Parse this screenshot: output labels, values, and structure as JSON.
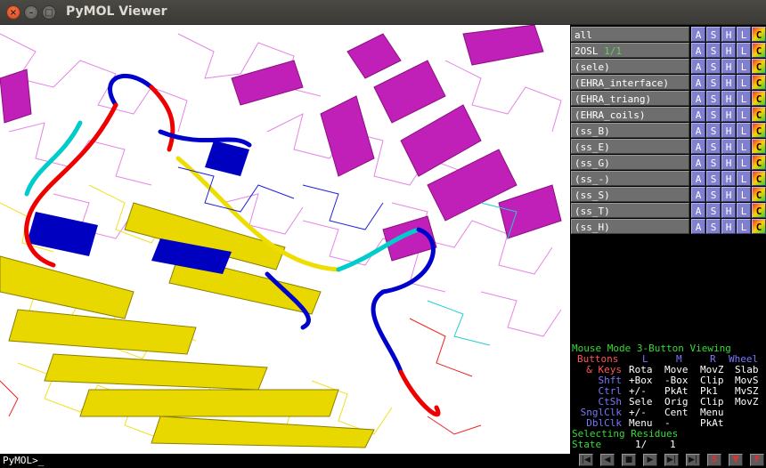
{
  "window": {
    "title": "PyMOL Viewer",
    "close_glyph": "×",
    "min_glyph": "–",
    "max_glyph": "□"
  },
  "viewport": {
    "description_icon": "molecular-viewport",
    "colors": {
      "chain_b": "#dd33cc",
      "chain_a": "#eedd00",
      "loop_blue": "#0000cc",
      "loop_red": "#ee0000",
      "loop_cyan": "#00cccc",
      "background": "#ffffff"
    }
  },
  "command": {
    "prompt": "PyMOL>_"
  },
  "objects": [
    {
      "name": "all",
      "suffix": ""
    },
    {
      "name": "2OSL",
      "suffix": "1/1"
    },
    {
      "name": "(sele)",
      "suffix": ""
    },
    {
      "name": "(EHRA_interface)",
      "suffix": ""
    },
    {
      "name": "(EHRA_triang)",
      "suffix": ""
    },
    {
      "name": "(EHRA_coils)",
      "suffix": ""
    },
    {
      "name": "(ss_B)",
      "suffix": ""
    },
    {
      "name": "(ss_E)",
      "suffix": ""
    },
    {
      "name": "(ss_G)",
      "suffix": ""
    },
    {
      "name": "(ss_-)",
      "suffix": ""
    },
    {
      "name": "(ss_S)",
      "suffix": ""
    },
    {
      "name": "(ss_T)",
      "suffix": ""
    },
    {
      "name": "(ss_H)",
      "suffix": ""
    }
  ],
  "object_buttons": [
    "A",
    "S",
    "H",
    "L",
    "C"
  ],
  "mouse": {
    "mode_label": "Mouse Mode 3-Button Viewing",
    "buttons_row": {
      "label": "Buttons",
      "L": "L",
      "M": "M",
      "R": "R",
      "Wheel": "Wheel"
    },
    "rows": [
      {
        "mod": "& Keys",
        "L": "Rota",
        "M": "Move",
        "R": "MovZ",
        "W": "Slab"
      },
      {
        "mod": "Shft",
        "L": "+Box",
        "M": "-Box",
        "R": "Clip",
        "W": "MovS"
      },
      {
        "mod": "Ctrl",
        "L": "+/-",
        "M": "PkAt",
        "R": "Pk1",
        "W": "MvSZ"
      },
      {
        "mod": "CtSh",
        "L": "Sele",
        "M": "Orig",
        "R": "Clip",
        "W": "MovZ"
      },
      {
        "mod": "SnglClk",
        "L": "+/-",
        "M": "Cent",
        "R": "Menu",
        "W": ""
      },
      {
        "mod": "DblClk",
        "L": "Menu",
        "M": "-",
        "R": "PkAt",
        "W": ""
      }
    ],
    "selecting": "Selecting Residues",
    "state_label": "State",
    "state_value": "1/",
    "state_total": "1"
  },
  "vcr": {
    "buttons": [
      {
        "name": "rewind-button",
        "glyph": "|◀"
      },
      {
        "name": "back-button",
        "glyph": "◀"
      },
      {
        "name": "stop-button",
        "glyph": "■"
      },
      {
        "name": "play-button",
        "glyph": "▶"
      },
      {
        "name": "forward-button",
        "glyph": "▶|"
      },
      {
        "name": "end-button",
        "glyph": "▶|"
      },
      {
        "name": "scene-button",
        "glyph": "S"
      },
      {
        "name": "toggle-button",
        "glyph": "▼"
      },
      {
        "name": "full-screen-button",
        "glyph": "F"
      }
    ]
  },
  "colors": {
    "mode_green": "#33dd33",
    "button_red": "#ff5555",
    "button_blue": "#7777ff",
    "object_button": "#8080cf"
  }
}
